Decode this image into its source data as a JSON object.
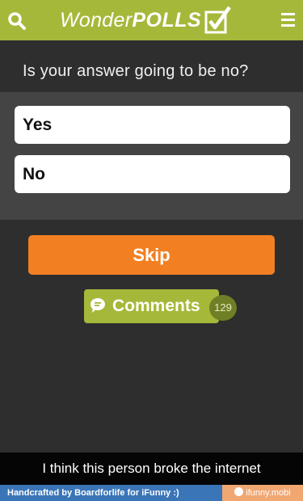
{
  "header": {
    "logo_wonder": "Wonder",
    "logo_polls": "POLLS",
    "search_icon": "search-icon",
    "menu_icon": "hamburger-menu-icon",
    "logo_icon": "checkbox-check-icon",
    "accent_color": "#a6b83a"
  },
  "poll": {
    "question": "Is your answer going to be no?",
    "answers": [
      {
        "label": "Yes"
      },
      {
        "label": "No"
      }
    ],
    "skip_label": "Skip",
    "skip_color": "#f28023"
  },
  "comments": {
    "label": "Comments",
    "count": "129",
    "icon": "speech-bubble-icon"
  },
  "caption": {
    "text": "I think this person broke the internet"
  },
  "footer": {
    "credit": "Handcrafted by Boardforlife for iFunny :)",
    "site": "ifunny.mobi",
    "site_icon": "smiley-icon"
  }
}
